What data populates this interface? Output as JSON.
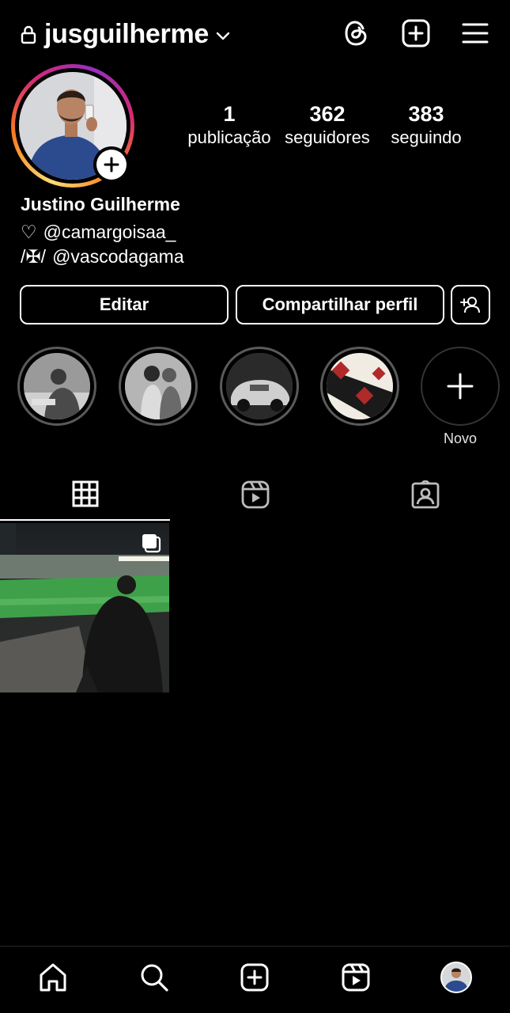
{
  "header": {
    "username": "jusguilherme",
    "icons": [
      "lock-icon",
      "chevron-down-icon",
      "threads-icon",
      "new-post-icon",
      "menu-icon"
    ]
  },
  "profile": {
    "stats": [
      {
        "value": "1",
        "label": "publicação"
      },
      {
        "value": "362",
        "label": "seguidores"
      },
      {
        "value": "383",
        "label": "seguindo"
      }
    ],
    "name": "Justino Guilherme",
    "bio": [
      {
        "prefix": "♡",
        "text": "@camargoisaa_"
      },
      {
        "prefix": "/✠/",
        "text": "@vascodagama"
      }
    ]
  },
  "buttons": {
    "edit": "Editar",
    "share": "Compartilhar perfil"
  },
  "highlights": {
    "new_label": "Novo"
  },
  "tabs": [
    "grid-icon",
    "reels-icon",
    "tagged-icon"
  ],
  "bottom_nav": [
    "home-icon",
    "search-icon",
    "create-icon",
    "reels-icon",
    "profile-avatar"
  ],
  "colors": {
    "background": "#000000",
    "story_ring": [
      "#feda75",
      "#fa7e1e",
      "#d62976",
      "#962fbf"
    ],
    "highlight_ring": "#5a5a5a"
  }
}
